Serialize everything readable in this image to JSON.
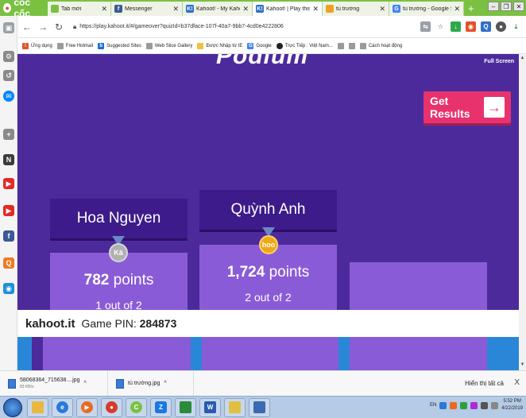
{
  "browser": {
    "brand": "cốc cốc",
    "tabs": [
      {
        "label": "Tab mới",
        "color": "#7ac142",
        "glyph": ""
      },
      {
        "label": "Messenger",
        "color": "#3b5998",
        "glyph": "f"
      },
      {
        "label": "Kahoot! - My Kahoots",
        "color": "#2f6fc9",
        "glyph": "K!"
      },
      {
        "label": "Kahoot! | Play this quiz",
        "color": "#2f6fc9",
        "glyph": "K!"
      },
      {
        "label": "tủ trường",
        "color": "#f0a020",
        "glyph": ""
      },
      {
        "label": "tủ trường - Google Sea",
        "color": "#4285f4",
        "glyph": "G"
      }
    ],
    "new_tab": "+",
    "url": "https://play.kahoot.it/#/gameover?quizId=b37dface-107f-40a7-9bb7-4cd0e4222806",
    "bookmarks": [
      {
        "label": "Ứng dụng",
        "color": "#e0522c"
      },
      {
        "label": "Free Hotmail",
        "color": "#9a9a9a"
      },
      {
        "label": "Suggested Sites",
        "color": "#1a6fd0"
      },
      {
        "label": "Web Slice Gallery",
        "color": "#9a9a9a"
      },
      {
        "label": "Được Nhập từ IE",
        "color": "#f0c040"
      },
      {
        "label": "Google",
        "color": "#4285f4"
      },
      {
        "label": "Trực Tiếp : Việt Nam...",
        "color": "#222222"
      },
      {
        "label": "",
        "color": "#9a9a9a"
      },
      {
        "label": "",
        "color": "#9a9a9a"
      },
      {
        "label": "Cách hoạt động",
        "color": "#9a9a9a"
      }
    ]
  },
  "page": {
    "heading": "Podium",
    "fullscreen": "Full Screen",
    "get_results": "Get Results",
    "get_results_arrow": "→",
    "podium": [
      {
        "name": "Hoa Nguyen",
        "points_value": "782",
        "points_word": "points",
        "position": "1 out of 2",
        "medal": "Kä",
        "medal_color": "#b0b0b0"
      },
      {
        "name": "Quỳnh Anh",
        "points_value": "1,724",
        "points_word": "points",
        "position": "2 out of 2",
        "medal": "hoo",
        "medal_color": "#f0a818"
      }
    ],
    "footer": {
      "site": "kahoot.it",
      "pin_label": "Game PIN:",
      "pin": "284873"
    }
  },
  "downloads": {
    "items": [
      {
        "name": "58068364_715638....jpg",
        "sub": "83 KB/s",
        "chevron": "^"
      },
      {
        "name": "tủ trường.jpg",
        "sub": "",
        "chevron": "^"
      }
    ],
    "show_all": "Hiển thị tất cả",
    "close": "X"
  },
  "taskbar": {
    "tray_lang": "EN",
    "time": "5:52 PM",
    "date": "4/22/2019"
  }
}
